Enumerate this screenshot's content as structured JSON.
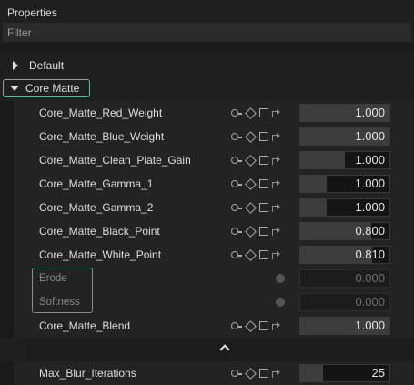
{
  "panel": {
    "title": "Properties"
  },
  "filter": {
    "placeholder": "Filter",
    "value": ""
  },
  "groups": [
    {
      "label": "Default",
      "expanded": false
    },
    {
      "label": "Core Matte",
      "expanded": true
    }
  ],
  "rows": [
    {
      "label": "Core_Matte_Red_Weight",
      "value": "1.000",
      "level": 1.0,
      "disabled": false
    },
    {
      "label": "Core_Matte_Blue_Weight",
      "value": "1.000",
      "level": 1.0,
      "disabled": false
    },
    {
      "label": "Core_Matte_Clean_Plate_Gain",
      "value": "1.000",
      "level": 0.5,
      "disabled": false
    },
    {
      "label": "Core_Matte_Gamma_1",
      "value": "1.000",
      "level": 0.3,
      "disabled": false
    },
    {
      "label": "Core_Matte_Gamma_2",
      "value": "1.000",
      "level": 0.3,
      "disabled": false
    },
    {
      "label": "Core_Matte_Black_Point",
      "value": "0.800",
      "level": 0.8,
      "disabled": false
    },
    {
      "label": "Core_Matte_White_Point",
      "value": "0.810",
      "level": 0.81,
      "disabled": false
    },
    {
      "label": "Erode",
      "value": "0.000",
      "level": 0,
      "disabled": true
    },
    {
      "label": "Softness",
      "value": "0.000",
      "level": 0,
      "disabled": true
    },
    {
      "label": "Core_Matte_Blend",
      "value": "1.000",
      "level": 1.0,
      "disabled": false
    },
    {
      "label": "Max_Blur_Iterations",
      "value": "25",
      "level": 0.25,
      "disabled": false
    }
  ],
  "icons": {
    "key": "keyframe-key-icon",
    "diamond": "keyframe-diamond-icon",
    "square": "reset-square-icon",
    "arrow": "link-arrow-icon",
    "collapse": "chevron-up-icon"
  },
  "colors": {
    "accent": "#68b59b",
    "background": "#1f1f1f",
    "field": "#141414",
    "fill": "#3d3d3d"
  }
}
